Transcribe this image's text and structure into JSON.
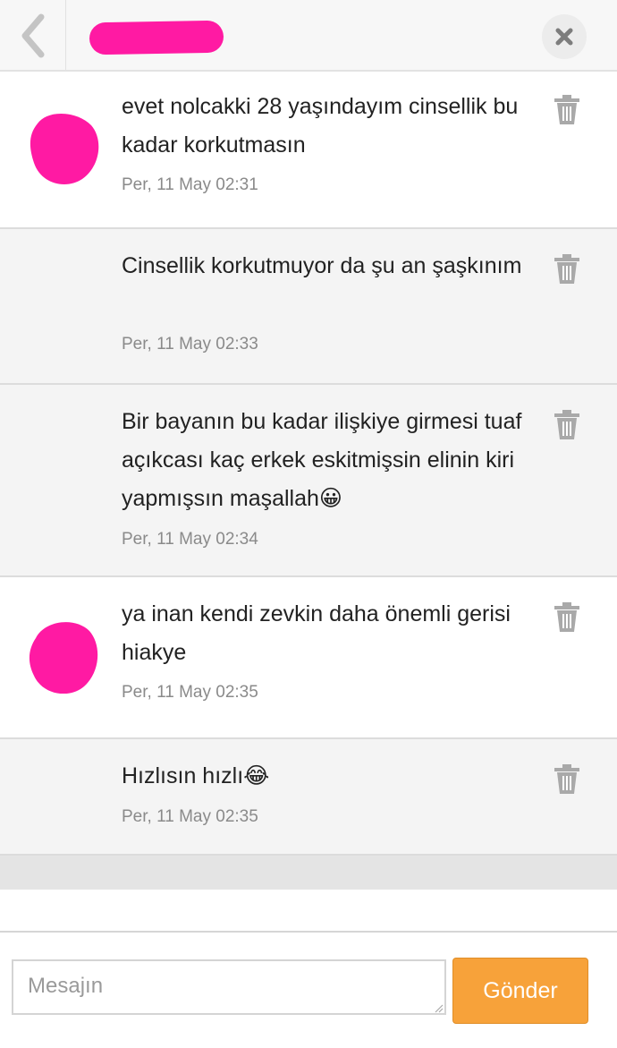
{
  "header": {
    "back_icon": "chevron-left-icon",
    "close_icon": "close-x-icon"
  },
  "messages": [
    {
      "text": "evet nolcakki 28 yaşındayım cinsellik bu kadar korkutmasın",
      "time": "Per, 11 May 02:31",
      "direction": "incoming"
    },
    {
      "text": "Cinsellik korkutmuyor da şu an şaşkınım",
      "time": "Per, 11 May 02:33",
      "direction": "outgoing"
    },
    {
      "text": "Bir bayanın bu kadar ilişkiye girmesi tuaf açıkcası kaç erkek eskitmişsin elinin kiri yapmışsın maşallah😀",
      "time": "Per, 11 May 02:34",
      "direction": "outgoing"
    },
    {
      "text": "ya inan kendi zevkin daha önemli gerisi hiakye",
      "time": "Per, 11 May 02:35",
      "direction": "incoming"
    },
    {
      "text": "Hızlısın hızlı😂",
      "time": "Per, 11 May 02:35",
      "direction": "outgoing"
    }
  ],
  "composer": {
    "placeholder": "Mesajın",
    "send_label": "Gönder"
  },
  "colors": {
    "accent": "#f7a23a",
    "redaction": "#ff1aa3",
    "outgoing_bg": "#f4f4f4"
  }
}
